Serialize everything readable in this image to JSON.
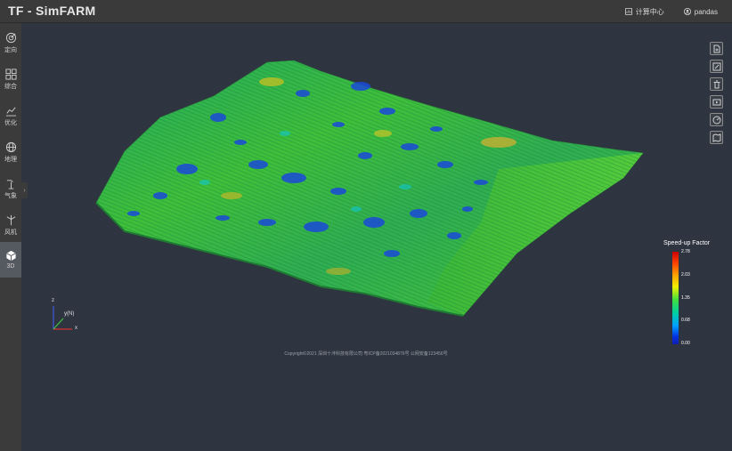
{
  "app": {
    "title": "TF - SimFARM"
  },
  "header": {
    "compute_label": "计算中心",
    "user_label": "pandas"
  },
  "sidebar": {
    "items": [
      {
        "label": "定向",
        "icon": "target-icon"
      },
      {
        "label": "综合",
        "icon": "grid-icon"
      },
      {
        "label": "优化",
        "icon": "chart-icon"
      },
      {
        "label": "地理",
        "icon": "globe-icon"
      },
      {
        "label": "气象",
        "icon": "anemometer-icon"
      },
      {
        "label": "风机",
        "icon": "turbine-icon"
      },
      {
        "label": "3D",
        "icon": "cube-icon",
        "active": true
      }
    ]
  },
  "toolbar": {
    "tools": [
      "new-file-icon",
      "edit-icon",
      "trash-icon",
      "video-icon",
      "speed-icon",
      "map-icon"
    ]
  },
  "legend": {
    "title": "Speed-up Factor",
    "ticks": [
      "2.78",
      "2.03",
      "1.35",
      "0.68",
      "0.00"
    ],
    "colors": [
      "#c80000",
      "#ffa000",
      "#f0f000",
      "#40e040",
      "#00a0ff",
      "#1020b0"
    ]
  },
  "axes": {
    "z": "z",
    "y": "y(N)",
    "x": "x"
  },
  "footer": {
    "copyright": "Copyright©2021 深圳十沣科技有限公司  粤ICP备2021034876号  公网安备123456号"
  }
}
